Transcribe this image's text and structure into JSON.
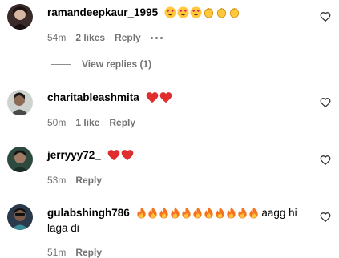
{
  "comments": [
    {
      "username": "ramandeepkaur_1995",
      "text": "",
      "emojis": [
        "heart-eyes",
        "heart-eyes",
        "heart-eyes",
        "clap",
        "clap",
        "clap"
      ],
      "time": "54m",
      "likes": "2 likes",
      "reply_label": "Reply",
      "view_replies": "View replies (1)"
    },
    {
      "username": "charitableashmita",
      "text": "",
      "emojis": [
        "red-heart",
        "red-heart"
      ],
      "time": "50m",
      "likes": "1 like",
      "reply_label": "Reply"
    },
    {
      "username": "jerryyy72_",
      "text": "",
      "emojis": [
        "red-heart",
        "red-heart"
      ],
      "time": "53m",
      "likes": "",
      "reply_label": "Reply"
    },
    {
      "username": "gulabshingh786",
      "text_after": "aagg hi",
      "text_line2": "laga di",
      "emojis": [
        "fire",
        "fire",
        "fire",
        "fire",
        "fire",
        "fire",
        "fire",
        "fire",
        "fire",
        "fire",
        "fire"
      ],
      "time": "51m",
      "likes": "",
      "reply_label": "Reply"
    }
  ],
  "colors": {
    "secondary_text": "#737373",
    "heart_red": "#e02e2e",
    "emoji_yellow": "#ffc83d"
  }
}
